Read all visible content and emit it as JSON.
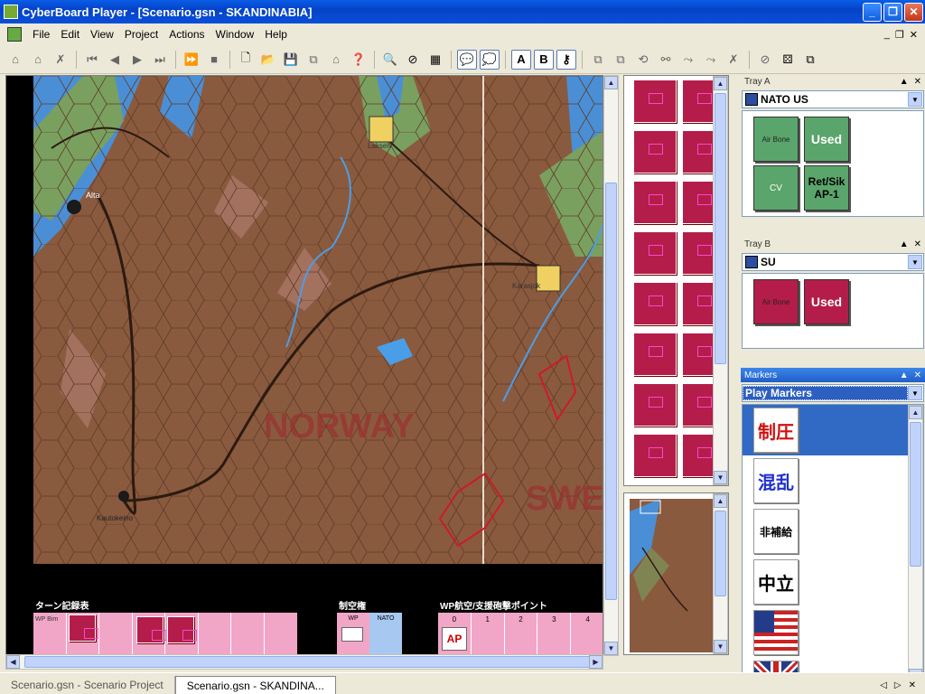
{
  "window": {
    "title": "CyberBoard Player - [Scenario.gsn - SKANDINABIA]",
    "minimize": "_",
    "maximize": "❐",
    "close": "✕"
  },
  "menu": {
    "items": [
      "File",
      "Edit",
      "View",
      "Project",
      "Actions",
      "Window",
      "Help"
    ],
    "right": [
      "_",
      "❐",
      "✕"
    ]
  },
  "toolbar": {
    "text_a": "A",
    "text_b": "B"
  },
  "map": {
    "labels": {
      "norway": "NORWAY",
      "sweden": "SWE",
      "alta": "Alta",
      "lakselv": "Lakselv",
      "karasjok": "Karasjok",
      "kautokeino": "Kautokeino"
    },
    "board": {
      "turn_record": "ターン記録表",
      "air_superiority": "制空権",
      "wp_air_points": "WP航空/支援砲撃ポイント",
      "wp_box": "WP\nBim",
      "air_wp": "WP",
      "air_nato": "NATO",
      "ap_numbers": [
        "0",
        "1",
        "2",
        "3",
        "4"
      ],
      "ap_marker": "AP"
    }
  },
  "tray_a": {
    "header": "Tray A",
    "selected": "NATO US",
    "counters": [
      {
        "label": "Air Bone",
        "style": "green"
      },
      {
        "label": "Used",
        "style": "green"
      },
      {
        "label": "CV",
        "style": "green"
      },
      {
        "label": "Ret/Sik\nAP-1",
        "style": "green"
      }
    ]
  },
  "tray_b": {
    "header": "Tray B",
    "selected": "SU",
    "counters": [
      {
        "label": "Air Bone",
        "style": "red"
      },
      {
        "label": "Used",
        "style": "red"
      }
    ]
  },
  "markers": {
    "header": "Markers",
    "selected": "Play Markers",
    "items": [
      "制圧",
      "混乱",
      "非補給",
      "中立",
      "US flag",
      "UK flag"
    ]
  },
  "tabs": {
    "items": [
      "Scenario.gsn - Scenario Project",
      "Scenario.gsn - SKANDINA..."
    ],
    "active_index": 1,
    "nav_prev": "◁",
    "nav_next": "▷",
    "nav_close": "✕"
  },
  "colors": {
    "titlebar": "#0a5de6",
    "map_terrain": "#8a5a3e",
    "counter_red": "#b41d4a",
    "counter_green": "#5aa56b",
    "selection": "#316ac5"
  }
}
